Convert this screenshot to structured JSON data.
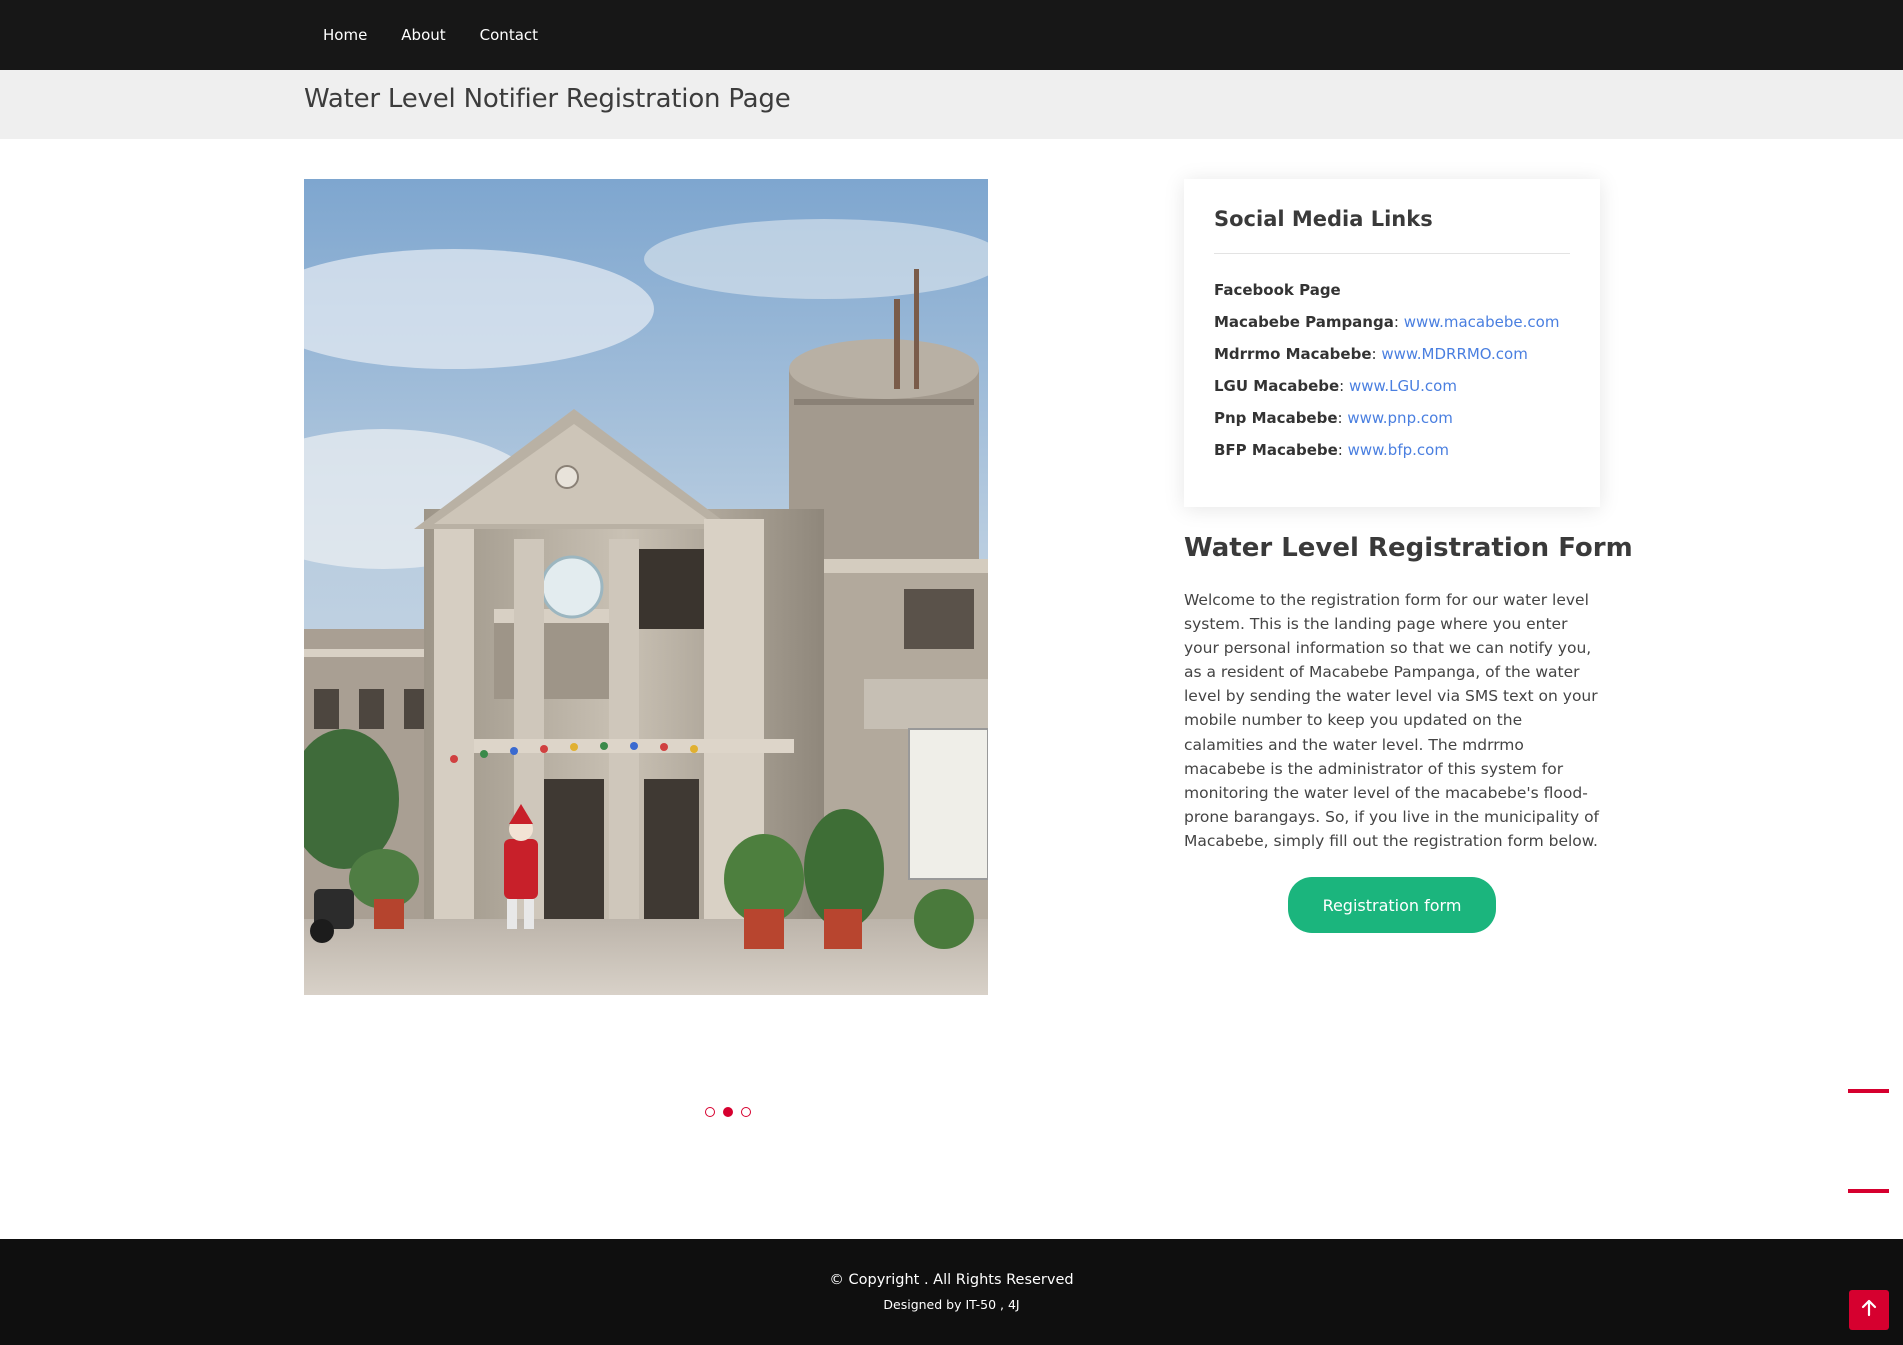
{
  "nav": {
    "items": [
      {
        "label": "Home"
      },
      {
        "label": "About"
      },
      {
        "label": "Contact"
      }
    ]
  },
  "page_title": "Water Level Notifier Registration Page",
  "carousel": {
    "image_description": "Macabebe municipal hall building",
    "active_index": 1,
    "dot_count": 3
  },
  "social": {
    "title": "Social Media Links",
    "facebook_label": "Facebook Page",
    "links": [
      {
        "name": "Macabebe Pampanga",
        "url": "www.macabebe.com"
      },
      {
        "name": "Mdrrmo Macabebe",
        "url": "www.MDRRMO.com"
      },
      {
        "name": "LGU Macabebe",
        "url": "www.LGU.com"
      },
      {
        "name": "Pnp Macabebe",
        "url": "www.pnp.com"
      },
      {
        "name": "BFP Macabebe",
        "url": "www.bfp.com"
      }
    ]
  },
  "form_section": {
    "title": "Water Level Registration Form",
    "description": "Welcome to the registration form for our water level system. This is the landing page where you enter your personal information so that we can notify you, as a resident of Macabebe Pampanga, of the water level by sending the water level via SMS text on your mobile number to keep you updated on the calamities and the water level. The mdrrmo macabebe is the administrator of this system for monitoring the water level of the macabebe's flood-prone barangays. So, if you live in the municipality of Macabebe, simply fill out the registration form below.",
    "button_label": "Registration form"
  },
  "footer": {
    "copyright": "© Copyright . All Rights Reserved",
    "designed_by": "Designed by IT-50 , 4J"
  },
  "colors": {
    "accent_red": "#d6002f",
    "button_green": "#1bb57d",
    "link_blue": "#4a7fe0",
    "nav_bg": "#171717"
  },
  "icons": {
    "back_to_top": "arrow-up-icon"
  }
}
